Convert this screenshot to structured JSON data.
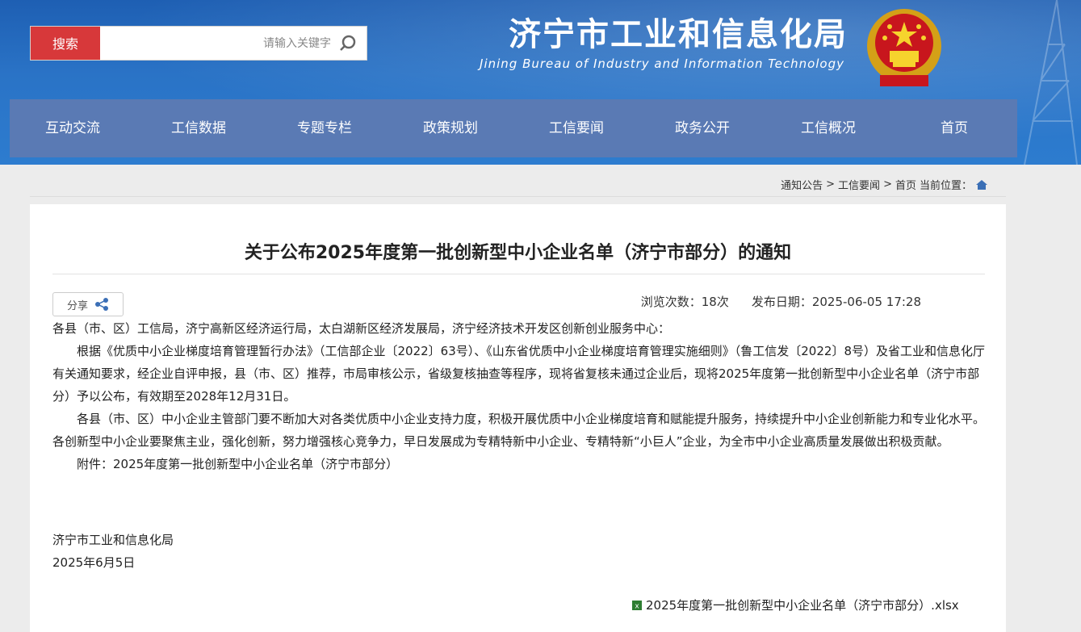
{
  "header": {
    "title": "济宁市工业和信息化局",
    "subtitle": "Jining Bureau of Industry and Information Technology",
    "emblem_icon": "national-emblem-icon"
  },
  "search": {
    "button_label": "搜索",
    "placeholder": "请输入关键字",
    "value": ""
  },
  "nav": {
    "items": [
      {
        "label": "首页"
      },
      {
        "label": "工信概况"
      },
      {
        "label": "政务公开"
      },
      {
        "label": "工信要闻"
      },
      {
        "label": "政策规划"
      },
      {
        "label": "专题专栏"
      },
      {
        "label": "工信数据"
      },
      {
        "label": "互动交流"
      }
    ]
  },
  "breadcrumb": {
    "prefix": "当前位置：",
    "items": [
      "首页",
      "工信要闻",
      "通知公告"
    ],
    "separator": ">"
  },
  "article": {
    "title": "关于公布2025年度第一批创新型中小企业名单（济宁市部分）的通知",
    "publish_date": "发布日期：2025-06-05 17:28",
    "views": "浏览次数：18次",
    "share_label": "分享",
    "paragraphs": [
      "各县（市、区）工信局，济宁高新区经济运行局，太白湖新区经济发展局，济宁经济技术开发区创新创业服务中心：",
      "根据《优质中小企业梯度培育管理暂行办法》（工信部企业〔2022〕63号）、《山东省优质中小企业梯度培育管理实施细则》（鲁工信发〔2022〕8号）及省工业和信息化厅有关通知要求，经企业自评申报，县（市、区）推荐，市局审核公示，省级复核抽查等程序，现将省复核未通过企业后，现将2025年度第一批创新型中小企业名单（济宁市部分）予以公布，有效期至2028年12月31日。",
      "各县（市、区）中小企业主管部门要不断加大对各类优质中小企业支持力度，积极开展优质中小企业梯度培育和赋能提升服务，持续提升中小企业创新能力和专业化水平。各创新型中小企业要聚焦主业，强化创新，努力增强核心竞争力，早日发展成为专精特新中小企业、专精特新“小巨人”企业，为全市中小企业高质量发展做出积极贡献。",
      "附件：2025年度第一批创新型中小企业名单（济宁市部分）"
    ],
    "signature": {
      "org": "济宁市工业和信息化局",
      "date": "2025年6月5日"
    },
    "attachment": {
      "filename": "2025年度第一批创新型中小企业名单（济宁市部分）.xlsx",
      "icon": "excel-file-icon"
    }
  },
  "colors": {
    "header_blue": "#2a73c6",
    "nav_blue": "#5a7ab4",
    "search_red": "#d7383a"
  }
}
